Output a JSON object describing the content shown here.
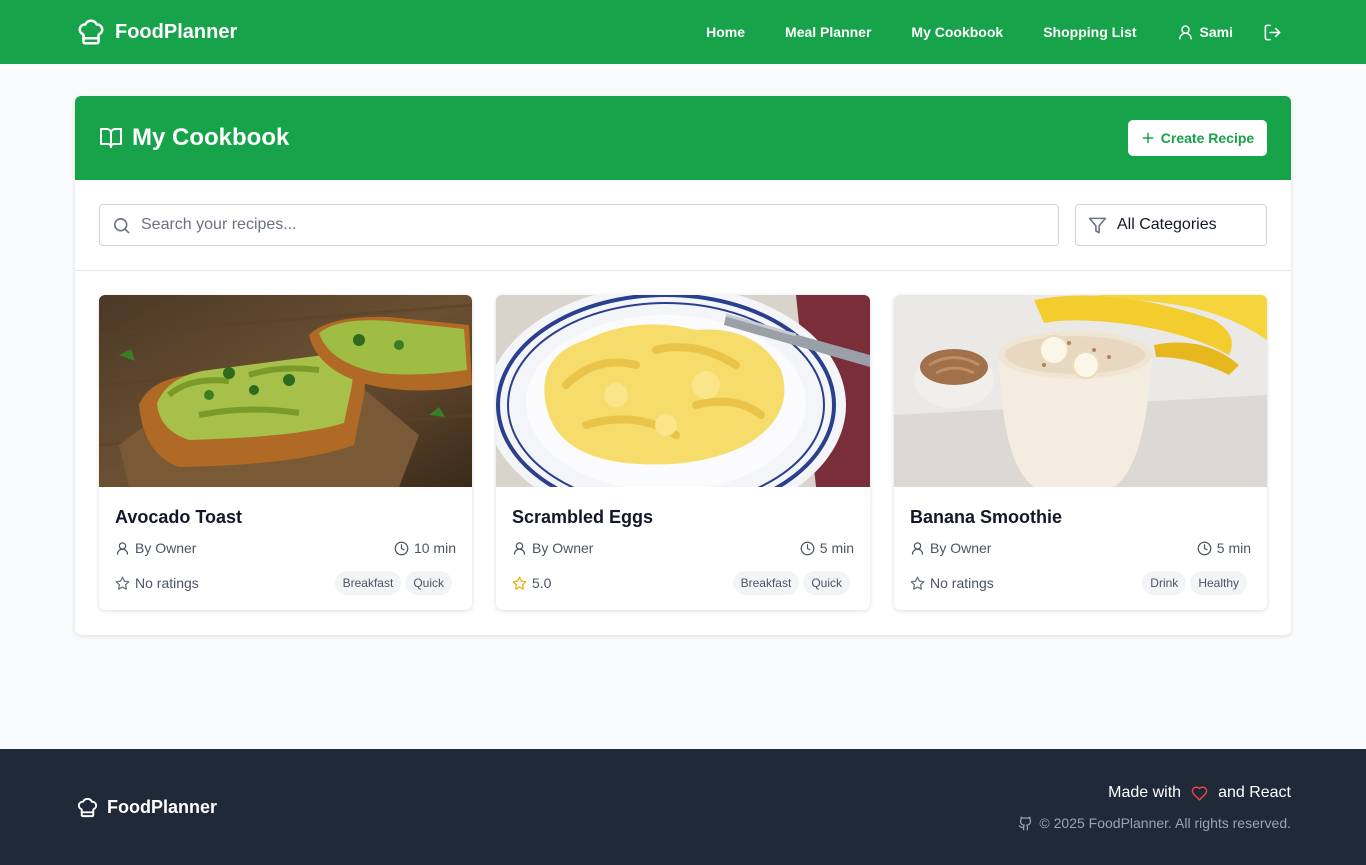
{
  "app": {
    "brand": "FoodPlanner"
  },
  "colors": {
    "primary": "#16a34a",
    "footer_bg": "#1f2937",
    "star": "#eab308",
    "heart": "#ef4444"
  },
  "nav": {
    "links": [
      "Home",
      "Meal Planner",
      "My Cookbook",
      "Shopping List"
    ],
    "user": "Sami",
    "icons": {
      "logo": "chef-hat-icon",
      "user": "user-icon",
      "logout": "logout-icon"
    }
  },
  "page": {
    "title": "My Cookbook",
    "create_button": "Create Recipe",
    "search_placeholder": "Search your recipes...",
    "category_filter": "All Categories"
  },
  "recipes": [
    {
      "title": "Avocado Toast",
      "author": "By Owner",
      "time": "10 min",
      "rating": "No ratings",
      "rated": false,
      "tags": [
        "Breakfast",
        "Quick"
      ]
    },
    {
      "title": "Scrambled Eggs",
      "author": "By Owner",
      "time": "5 min",
      "rating": "5.0",
      "rated": true,
      "tags": [
        "Breakfast",
        "Quick"
      ]
    },
    {
      "title": "Banana Smoothie",
      "author": "By Owner",
      "time": "5 min",
      "rating": "No ratings",
      "rated": false,
      "tags": [
        "Drink",
        "Healthy"
      ]
    }
  ],
  "footer": {
    "brand": "FoodPlanner",
    "made_with_prefix": "Made with",
    "made_with_suffix": "and React",
    "copyright": "© 2025 FoodPlanner. All rights reserved."
  }
}
